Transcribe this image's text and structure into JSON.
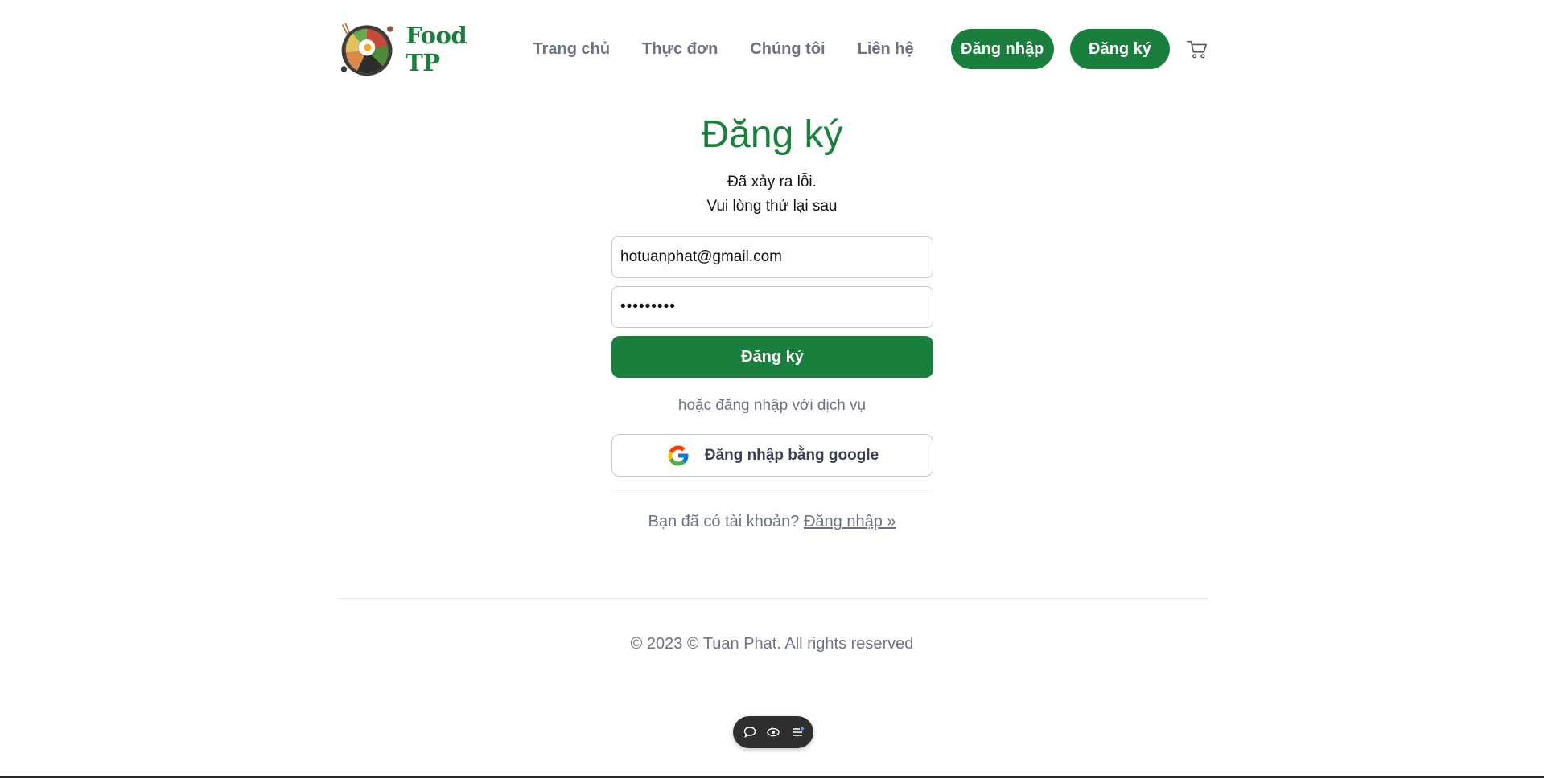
{
  "brand": {
    "name": "Food TP"
  },
  "nav": {
    "items": [
      {
        "label": "Trang chủ"
      },
      {
        "label": "Thực đơn"
      },
      {
        "label": "Chúng tôi"
      },
      {
        "label": "Liên hệ"
      }
    ],
    "login_label": "Đăng nhập",
    "signup_label": "Đăng ký"
  },
  "page": {
    "title": "Đăng ký",
    "error_line1": "Đã xảy ra lỗi.",
    "error_line2": "Vui lòng thử lại sau"
  },
  "form": {
    "email_value": "hotuanphat@gmail.com",
    "password_value": "•••••••••",
    "submit_label": "Đăng ký",
    "or_text": "hoặc đăng nhập với dịch vụ",
    "google_label": "Đăng nhập bằng google",
    "have_account_text": "Bạn đã có tài khoản?",
    "login_link": "Đăng nhập »"
  },
  "footer": {
    "text": "© 2023 © Tuan Phat. All rights reserved"
  },
  "colors": {
    "brand_green": "#1a7f3c",
    "muted_gray": "#6b7280"
  },
  "icons": {
    "logo": "food-bowl-icon",
    "cart": "cart-icon",
    "google": "google-icon",
    "toolbar": [
      "comment-icon",
      "eye-icon",
      "menu-icon"
    ]
  }
}
